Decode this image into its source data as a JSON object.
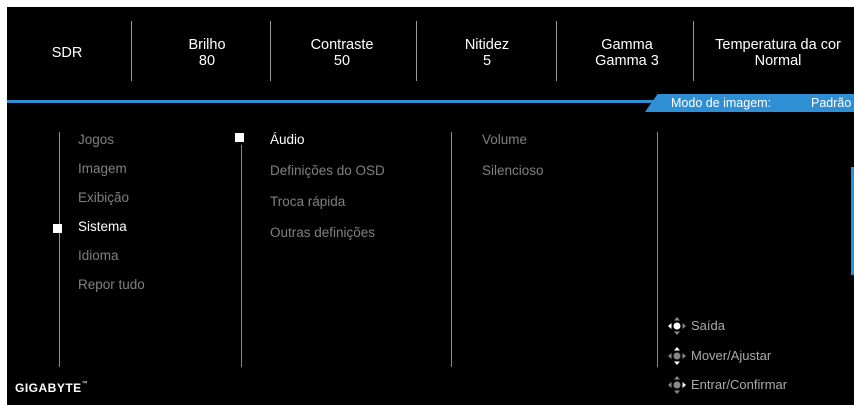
{
  "top_bar": {
    "sdr": "SDR",
    "brightness_label": "Brilho",
    "brightness_value": "80",
    "contrast_label": "Contraste",
    "contrast_value": "50",
    "sharpness_label": "Nitidez",
    "sharpness_value": "5",
    "gamma_label": "Gamma",
    "gamma_value": "Gamma 3",
    "color_temp_label": "Temperatura da cor",
    "color_temp_value": "Normal"
  },
  "mode": {
    "label": "Modo de imagem:",
    "value": "Padrão"
  },
  "main_menu": [
    {
      "label": "Jogos",
      "selected": false
    },
    {
      "label": "Imagem",
      "selected": false
    },
    {
      "label": "Exibição",
      "selected": false
    },
    {
      "label": "Sistema",
      "selected": true
    },
    {
      "label": "Idioma",
      "selected": false
    },
    {
      "label": "Repor tudo",
      "selected": false
    }
  ],
  "sub_menu": [
    {
      "label": "Áudio",
      "selected": true
    },
    {
      "label": "Definições do OSD",
      "selected": false
    },
    {
      "label": "Troca rápida",
      "selected": false
    },
    {
      "label": "Outras definições",
      "selected": false
    }
  ],
  "options_menu": [
    {
      "label": "Volume"
    },
    {
      "label": "Silencioso"
    }
  ],
  "hints": {
    "exit": "Saída",
    "move_adjust": "Mover/Ajustar",
    "enter_confirm": "Entrar/Confirmar"
  },
  "brand": {
    "logo_text": "GIGABYTE",
    "logo_mark": "™"
  },
  "colors": {
    "accent": "#2f8fd4",
    "background": "#000000",
    "inactive_text": "#808080",
    "active_text": "#ffffff"
  },
  "icons": {
    "exit": "joystick-left-icon",
    "move_adjust": "joystick-updown-icon",
    "enter_confirm": "joystick-center-icon"
  }
}
